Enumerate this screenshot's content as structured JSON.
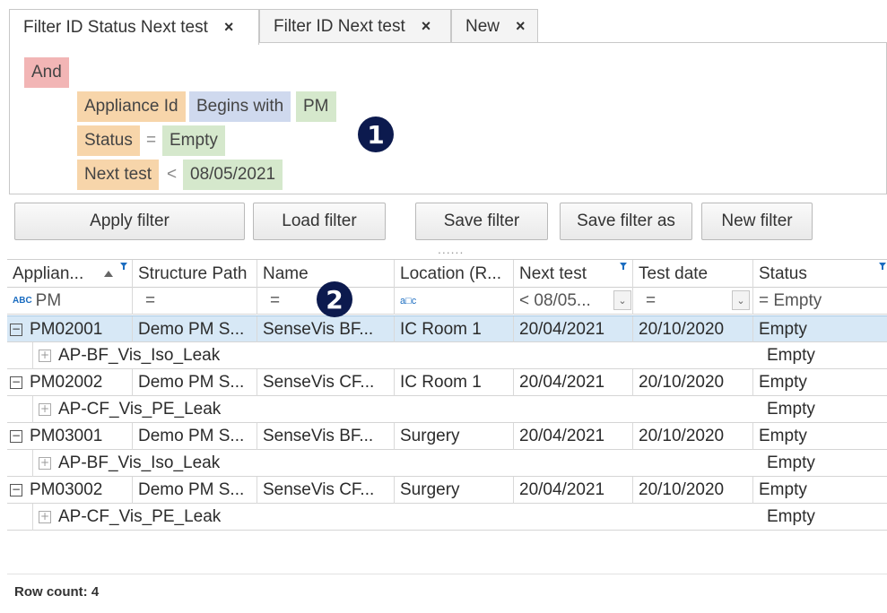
{
  "tabs": [
    {
      "label": "Filter ID Status Next test",
      "close": "×",
      "active": true
    },
    {
      "label": "Filter ID Next test",
      "close": "×",
      "active": false
    },
    {
      "label": "New",
      "close": "×",
      "active": false
    }
  ],
  "filter": {
    "group_op": "And",
    "conditions": [
      {
        "field": "Appliance Id",
        "operator": "Begins with",
        "value": "PM"
      },
      {
        "field": "Status",
        "operator": "=",
        "value": "Empty"
      },
      {
        "field": "Next test",
        "operator": "<",
        "value": "08/05/2021"
      }
    ]
  },
  "badges": {
    "one": "1",
    "two": "2"
  },
  "buttons": {
    "apply": "Apply filter",
    "load": "Load filter",
    "save": "Save filter",
    "save_as": "Save filter as",
    "new": "New filter"
  },
  "splitter": "......",
  "grid": {
    "columns": [
      "Applian...",
      "Structure Path",
      "Name",
      "Location (R...",
      "Next test",
      "Test date",
      "Status"
    ],
    "filter_row": {
      "appliance": "PM",
      "structure": "=",
      "name": "=",
      "location": "a□c",
      "next_test": "< 08/05...",
      "test_date": "=",
      "status": "= Empty"
    },
    "rows": [
      {
        "id": "PM02001",
        "structure": "Demo PM S...",
        "name": "SenseVis BF...",
        "location": "IC Room 1",
        "next_test": "20/04/2021",
        "test_date": "20/10/2020",
        "status": "Empty",
        "child": "AP-BF_Vis_Iso_Leak",
        "child_status": "Empty",
        "selected": true
      },
      {
        "id": "PM02002",
        "structure": "Demo PM S...",
        "name": "SenseVis CF...",
        "location": "IC Room 1",
        "next_test": "20/04/2021",
        "test_date": "20/10/2020",
        "status": "Empty",
        "child": "AP-CF_Vis_PE_Leak",
        "child_status": "Empty",
        "selected": false
      },
      {
        "id": "PM03001",
        "structure": "Demo PM S...",
        "name": "SenseVis BF...",
        "location": "Surgery",
        "next_test": "20/04/2021",
        "test_date": "20/10/2020",
        "status": "Empty",
        "child": "AP-BF_Vis_Iso_Leak",
        "child_status": "Empty",
        "selected": false
      },
      {
        "id": "PM03002",
        "structure": "Demo PM S...",
        "name": "SenseVis CF...",
        "location": "Surgery",
        "next_test": "20/04/2021",
        "test_date": "20/10/2020",
        "status": "Empty",
        "child": "AP-CF_Vis_PE_Leak",
        "child_status": "Empty",
        "selected": false
      }
    ]
  },
  "footer": {
    "row_count": "Row count: 4"
  },
  "colors": {
    "and": "#f2b5b5",
    "field": "#f7d5aa",
    "operator": "#cfd9ee",
    "value": "#d5e8cc",
    "selected_row": "#d7e8f6",
    "badge": "#0c1a4e"
  }
}
